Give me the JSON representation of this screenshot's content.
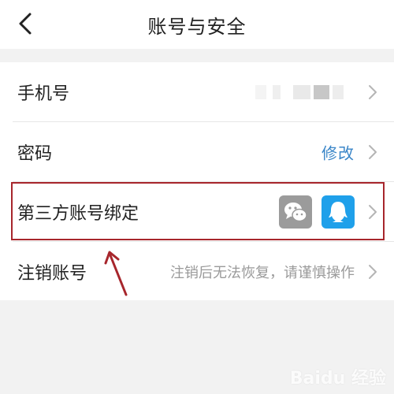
{
  "header": {
    "title": "账号与安全"
  },
  "rows": [
    {
      "label": "手机号"
    },
    {
      "label": "密码",
      "action": "修改"
    },
    {
      "label": "第三方账号绑定",
      "icons": [
        "wechat-icon",
        "qq-icon"
      ]
    },
    {
      "label": "注销账号",
      "hint": "注销后无法恢复，请谨慎操作"
    }
  ],
  "colors": {
    "accent": "#3a86c8",
    "highlight_border": "#a7262c",
    "qq_blue": "#1fa0ea",
    "wechat_gray": "#9b9b9b"
  },
  "watermark": "Baidu 经验"
}
